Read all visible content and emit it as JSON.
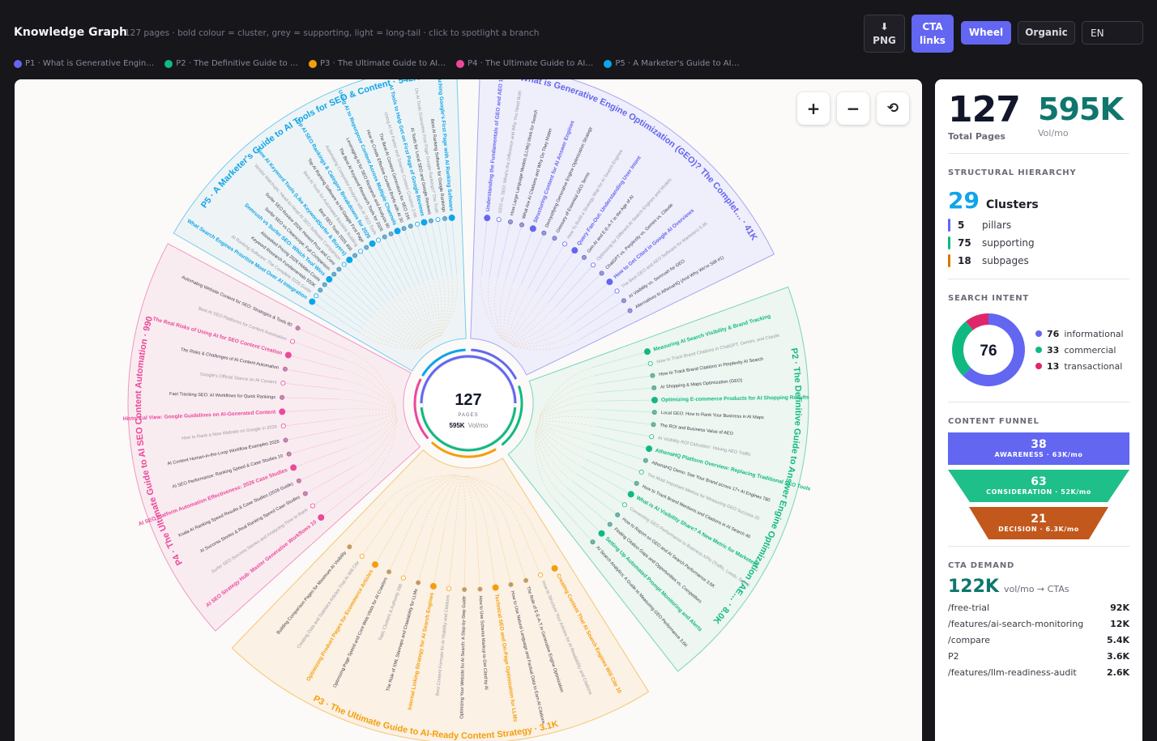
{
  "header": {
    "title": "Knowledge Graph",
    "subtitle": "127 pages · bold colour = cluster, grey = supporting, light = long-tail · click to spotlight a branch"
  },
  "toolbar": {
    "png_icon": "⬇",
    "png_label": "PNG",
    "cta_line1": "CTA",
    "cta_line2": "links",
    "wheel_label": "Wheel",
    "organic_label": "Organic",
    "language": "EN"
  },
  "legend": [
    {
      "label": "P1 · What is Generative Engin…",
      "color": "#6366f1"
    },
    {
      "label": "P2 · The Definitive Guide to …",
      "color": "#10b981"
    },
    {
      "label": "P3 · The Ultimate Guide to AI…",
      "color": "#f59e0b"
    },
    {
      "label": "P4 · The Ultimate Guide to AI…",
      "color": "#ec4899"
    },
    {
      "label": "P5 · A Marketer's Guide to AI…",
      "color": "#0ea5e9"
    }
  ],
  "zoom": {
    "in": "+",
    "out": "−",
    "reset": "⟲"
  },
  "wheel": {
    "center_num": "127",
    "center_label": "PAGES",
    "center_vol": "595K",
    "center_vol_unit": "Vol/mo",
    "pillars": [
      {
        "label": "P1 · What is Generative Engine Optimization (GEO)? The Complet… · 41K",
        "color": "#6366f1",
        "bg": "#efeefb",
        "leaves": [
          "Understanding the Fundamentals of GEO and AEO 1.3K",
          "GEO vs. SEO: What's the Difference and Why You Need Both",
          "How Large Language Models (LLMs) Work for Search",
          "What Are AI Citations and Why Do They Matter",
          "Structuring Content for AI Answer Engines",
          "Demystifying Generative Engine Optimization Strategy",
          "Glossary of Essential GEO Terms",
          "How To Build a Strategy Map for AI Search Engines",
          "Query Fan-Out: Understanding User Intent",
          "Gen AI and E-E-A-T in the Age of AI",
          "Optimizing for Different AI Search Engines and Models",
          "ChatGPT vs. Perplexity vs. Gemini vs. Claude",
          "How to Get Cited in Google AI Overviews",
          "The Best GEO and AEO Software for Marketers 5.4K",
          "AI Visibility vs. Semrush for GEO",
          "Alternatives to AthenaHQ (And Why We're Still #1)"
        ]
      },
      {
        "label": "P2 · The Definitive Guide to Answer Engine Optimization (AE… · 8.0K",
        "color": "#10b981",
        "bg": "#edf6f1",
        "leaves": [
          "Measuring AI Search Visibility & Brand Tracking",
          "How to Track Brand Citations in ChatGPT, Gemini, and Claude",
          "How to Track Brand Citations in Perplexity AI Search",
          "AI Shopping & Maps Optimization (GEO)",
          "Optimizing E-commerce Products for AI Shopping Results",
          "Local GEO: How to Rank Your Business in AI Maps",
          "The ROI and Business Value of AEO",
          "AI Visibility ROI Calculator: Valuing AEO Traffic",
          "AthenaHQ Platform Overview: Replacing Traditional SEO Tools",
          "AthenaHQ Demo: See Your Brand across 17+ AI Engines 780",
          "The Most Important Metrics for Measuring GEO Success 20",
          "How to Track Brand Mentions and Citations in AI Search 40",
          "What is AI Visibility Share? A New Metric for Marketers",
          "Connecting GEO Performance to Business KPIs (Traffic, Leads, Sales)",
          "How to Report on GEO and AI Search Performance 3.6K",
          "Finding Citation Gaps and Opportunities vs. Competitors",
          "Setting Up Automated Prompt Monitoring and Alerts",
          "AI Search Analytics: A Guide to Measuring GEO Performance 3.6K"
        ]
      },
      {
        "label": "P3 · The Ultimate Guide to AI-Ready Content Strategy · 3.1K",
        "color": "#f59e0b",
        "bg": "#fbf1e4",
        "leaves": [
          "Creating Content That AI Search Engines Will Cite 10",
          "How to Structure Your Articles for AI Readability and Citations",
          "The Role of E-E-A-T in Generative Engine Optimization",
          "How to Use Natural Language and Factual Data to Earn AI Citations",
          "Technical SEO and On-Page Optimization for LLMs",
          "How to Use Schema Markup to Get Cited by AI",
          "Optimizing Your Website for AI Search: A Step-by-Step Guide",
          "Best Content Formats for AI Visibility and Citations",
          "Internal Linking Strategy for AI Search Engines",
          "The Role of XML Sitemaps and Crawlability for LLMs",
          "Topic Clusters & Authority 390",
          "Optimizing Page Speed and Core Web Vitals for AI Crawlers",
          "Optimizing Product Pages for Ecommerce Articles",
          "Creating Data and Statistics Articles That AI Will Cite",
          "Building Comparison Pages for Maximum AI Visibility"
        ]
      },
      {
        "label": "P4 · The Ultimate Guide to AI SEO Content Automation · 990",
        "color": "#ec4899",
        "bg": "#f9ecf1",
        "leaves": [
          "AI SEO Strategy Hub: Master Generative Workflows 10",
          "Surfer SEO Success Stories and Analyzing Time to Rank",
          "AI Success Stories & Real Ranking Speed Case Studies",
          "Koala AI Ranking Speed Results & Case Studies (2026 Guide)",
          "AI SEO Platform Automation Effectiveness: 2026 Case Studies",
          "AI SEO Performance: Ranking Speed & Case Studies 10",
          "AI Content Human-in-the-Loop Workflow Examples 2026",
          "How to Rank a New Website on Google in 2026",
          "Historical View: Google Guidelines on AI-Generated Content",
          "Fast Tracking SEO: AI Workflows for Quick Rankings",
          "Google's Official Stance on AI Content",
          "The Risks & Challenges of AI Content Automation",
          "The Real Risks of Using AI for SEO Content Creation",
          "Best AI SEO Platforms for Content Automation",
          "Automating Website Content for SEO: Strategies & Tools 80"
        ]
      },
      {
        "label": "P5 · A Marketer's Guide to AI Tools for SEO & Content · 542K",
        "color": "#0ea5e9",
        "bg": "#eef4f6",
        "leaves": [
          "What Search Engines Prioritize Most Over AI Integration",
          "AI Ranking Software: The Complete 2026 Guide",
          "Keyword Research Fundamentals 550K",
          "Alsoasked Pricing 2026 Hidden Costs",
          "Semrush vs Surfer SEO: Which Tool Wins",
          "Surfer SEO vs Clearscope: Full Comparison",
          "Surfer SEO Review 2026: Honest Pros and Cons",
          "Vendor Matchups: Head-to-Head AI SEO Software Comparison",
          "New AI Keyword Tools (Like KeywordSurfer & Buyers)",
          "Best SEO Tools 2026 400",
          "Best AI Tools for Automated Backlink Building",
          "Top AI Ranking Software to Hit Google First Page",
          "Top AI SEO Rankings & Category Breakdowns for 2026",
          "Automating Competitor Analysis with AI SEO Tools",
          "The Best AI Keyword Research Tools for 2026",
          "Leveraging AI for SEO Research and Analysis 90",
          "Using AI to Repurpose Content Across Multiple Channels",
          "How to Create Effective Content Briefs with AI 30",
          "The Best AI Content Generators for SEO 16K",
          "Using AI for Faster and Smarter Content Creation 3.6K",
          "AI Tools to Help Get on First Page of Google Reviews",
          "AI Tools for Local SEO and Google Reviews",
          "Do AI Tools Guarantee First Page Google Rankings? The Truth",
          "Best AI Ranking Software for Google Rankings",
          "Reaching Google's First Page with AI Ranking Software"
        ]
      }
    ]
  },
  "sidebar": {
    "total_pages": "127",
    "total_pages_label": "Total Pages",
    "volume": "595K",
    "volume_label": "Vol/mo",
    "hierarchy_title": "STRUCTURAL HIERARCHY",
    "clusters_num": "29",
    "clusters_label": "Clusters",
    "hierarchy": [
      {
        "num": "5",
        "label": "pillars",
        "color": "#6366f1"
      },
      {
        "num": "75",
        "label": "supporting",
        "color": "#10b981"
      },
      {
        "num": "18",
        "label": "subpages",
        "color": "#d97706"
      }
    ],
    "intent_title": "SEARCH INTENT",
    "intent_center": "76",
    "intent": [
      {
        "num": "76",
        "label": "informational",
        "color": "#6366f1",
        "value": 76
      },
      {
        "num": "33",
        "label": "commercial",
        "color": "#10b981",
        "value": 33
      },
      {
        "num": "13",
        "label": "transactional",
        "color": "#e0266b",
        "value": 13
      }
    ],
    "funnel_title": "CONTENT FUNNEL",
    "funnel": [
      {
        "num": "38",
        "label": "AWARENESS · 63K/mo",
        "color": "#6366f1"
      },
      {
        "num": "63",
        "label": "CONSIDERATION · 52K/mo",
        "color": "#1fbf8a"
      },
      {
        "num": "21",
        "label": "DECISION · 6.3K/mo",
        "color": "#c2581c"
      }
    ],
    "cta_title": "CTA DEMAND",
    "cta_total": "122K",
    "cta_sub": "vol/mo → CTAs",
    "cta_rows": [
      {
        "path": "/free-trial",
        "value": "92K"
      },
      {
        "path": "/features/ai-search-monitoring",
        "value": "12K"
      },
      {
        "path": "/compare",
        "value": "5.4K"
      },
      {
        "path": "P2",
        "value": "3.6K"
      },
      {
        "path": "/features/llm-readiness-audit",
        "value": "2.6K"
      }
    ]
  }
}
